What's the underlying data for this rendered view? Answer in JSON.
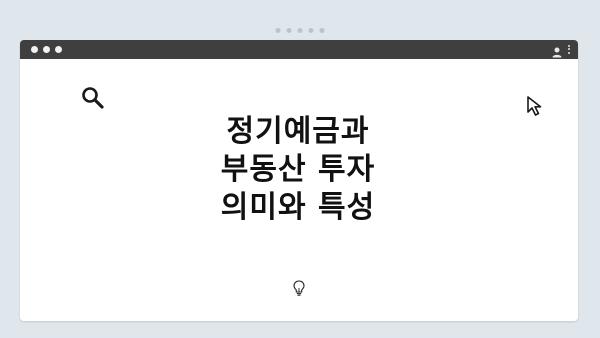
{
  "window": {
    "headline_lines": [
      "정기예금과",
      "부동산 투자",
      "의미와 특성"
    ]
  },
  "icons": {
    "top_dots": "tab-indicator-dots",
    "traffic_lights": "window-controls",
    "user": "user-icon",
    "menu": "kebab-menu-icon",
    "search": "search-icon",
    "cursor": "cursor-arrow-icon",
    "idea": "lightbulb-icon"
  },
  "colors": {
    "background": "#dfe6ec",
    "titlebar": "#3f3f3f",
    "window": "#ffffff",
    "text": "#111111"
  }
}
